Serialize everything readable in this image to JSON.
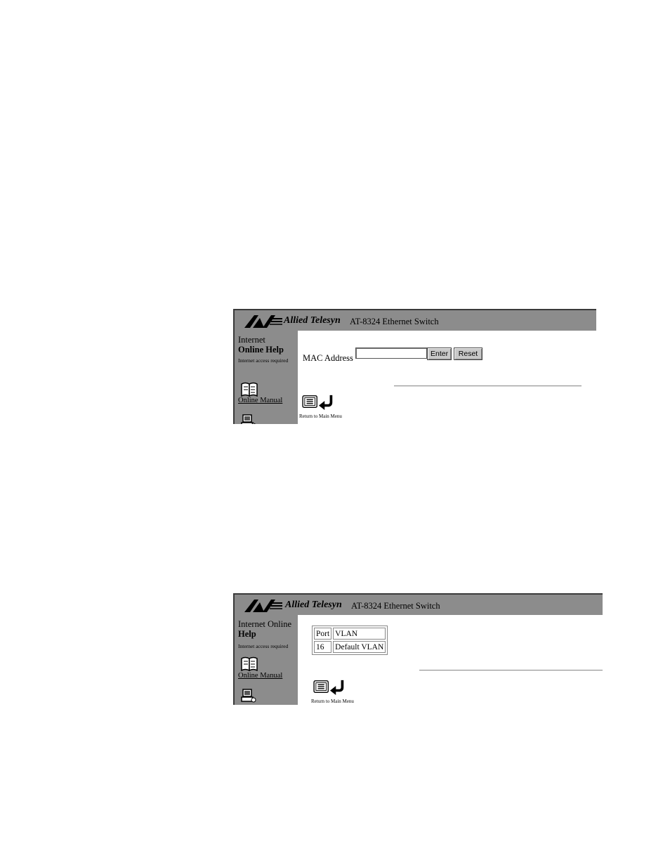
{
  "screens": [
    {
      "header": {
        "brand": "Allied Telesyn",
        "product": "AT-8324  Ethernet Switch"
      },
      "sidebar": {
        "help_title_line1": "Internet",
        "help_title_line2": "Online Help",
        "help_note": "Internet access required",
        "manual_link": "Online Manual",
        "icons": [
          "book-icon",
          "computer-icon"
        ]
      },
      "form": {
        "mac_label": "MAC Address",
        "mac_value": "",
        "enter_label": "Enter",
        "reset_label": "Reset"
      },
      "return_text": "Return to Main Menu"
    },
    {
      "header": {
        "brand": "Allied Telesyn",
        "product": "AT-8324  Ethernet Switch"
      },
      "sidebar": {
        "help_title_line1": "Internet Online",
        "help_title_line2": "Help",
        "help_note": "Internet access required",
        "manual_link": "Online Manual",
        "icons": [
          "book-icon",
          "computer-icon"
        ]
      },
      "table": {
        "headers": [
          "Port",
          "VLAN"
        ],
        "rows": [
          [
            "16",
            "Default VLAN"
          ]
        ]
      },
      "return_text": "Return to Main Menu"
    }
  ]
}
